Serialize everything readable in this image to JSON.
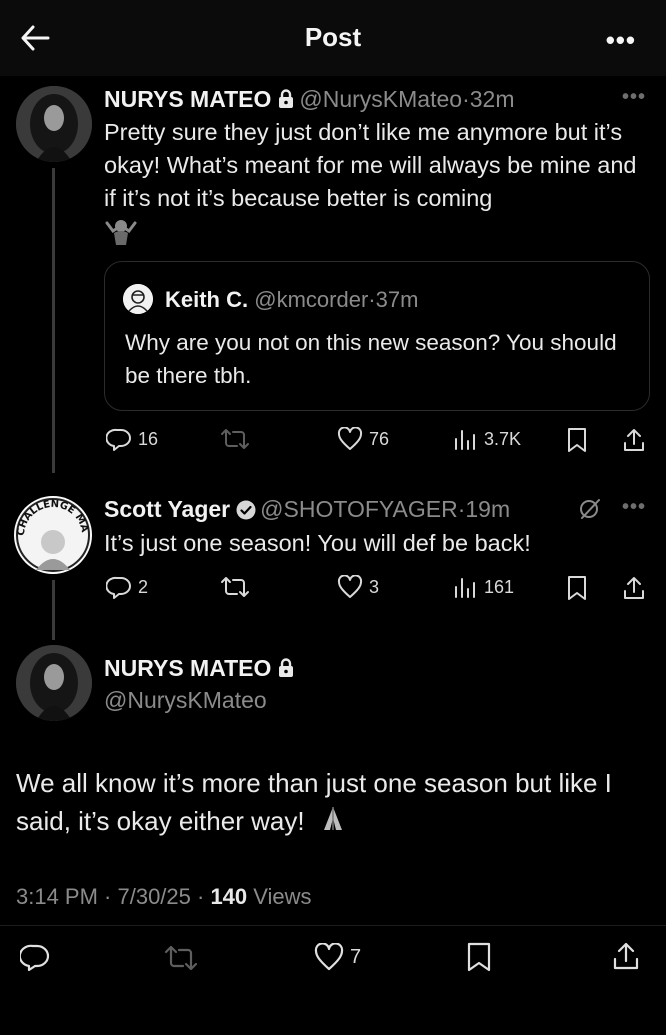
{
  "header": {
    "title": "Post",
    "more_label": "•••"
  },
  "reply_tweet": {
    "author_name": "NURYS MATEO",
    "handle": "@NurysKMateo",
    "time": "·32m",
    "more_label": "•••",
    "text": "Pretty sure they just don’t like me anymore but it’s okay! What’s meant for me will always be mine and if it’s not it’s because better is coming",
    "quote": {
      "author_name": "Keith C.",
      "handle": "@kmcorder",
      "time": "·37m",
      "text": "Why are you not on this new season? You should be there tbh."
    },
    "actions": {
      "replies": "16",
      "reposts": "",
      "likes": "76",
      "views": "3.7K"
    }
  },
  "scott_tweet": {
    "author_name": "Scott Yager",
    "handle": "@SHOTOFYAGER",
    "time": "·19m",
    "more_label": "•••",
    "avatar_text": "CHALLENGE MANIA",
    "text": "It’s just one season! You will def be back!",
    "actions": {
      "replies": "2",
      "reposts": "",
      "likes": "3",
      "views": "161"
    }
  },
  "main_tweet": {
    "author_name": "NURYS MATEO",
    "handle": "@NurysKMateo",
    "text": "We all know it’s more than just one season but like I said, it’s okay either way!",
    "timestamp": "3:14 PM · 7/30/25 · ",
    "views_count": "140",
    "views_label": " Views",
    "actions": {
      "likes": "7"
    }
  },
  "colors": {
    "background": "#000000",
    "text": "#e7e9ea",
    "muted": "#8b8b8b",
    "divider": "#2b2b2b"
  }
}
